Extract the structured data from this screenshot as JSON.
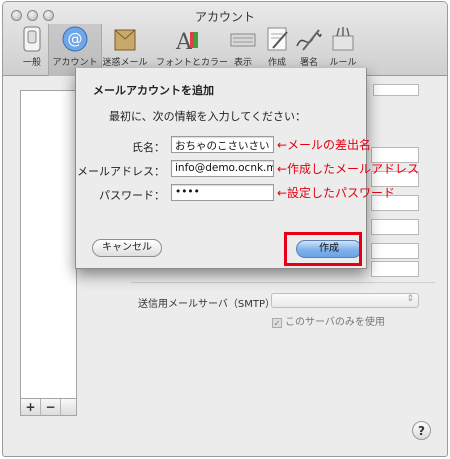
{
  "window": {
    "title": "アカウント"
  },
  "toolbar": {
    "items": [
      {
        "label": "一般",
        "icon": "switch-icon"
      },
      {
        "label": "アカウント",
        "icon": "at-sign-icon",
        "selected": true
      },
      {
        "label": "迷惑メール",
        "icon": "junk-mail-icon"
      },
      {
        "label": "フォントとカラー",
        "icon": "fonts-colors-icon"
      },
      {
        "label": "表示",
        "icon": "view-icon"
      },
      {
        "label": "作成",
        "icon": "compose-icon"
      },
      {
        "label": "署名",
        "icon": "signature-icon"
      },
      {
        "label": "ルール",
        "icon": "rules-icon"
      }
    ]
  },
  "sidebar": {
    "add_label": "+",
    "remove_label": "−"
  },
  "background": {
    "smtp_label": "送信用メールサーバ（SMTP）：",
    "smtp_checkbox_label": "このサーバのみを使用",
    "help_label": "?"
  },
  "sheet": {
    "title": "メールアカウントを追加",
    "subtitle": "最初に、次の情報を入力してください：",
    "fields": [
      {
        "label": "氏名：",
        "value": "おちゃのこさいさい"
      },
      {
        "label": "メールアドレス：",
        "value": "info@demo.ocnk.me"
      },
      {
        "label": "パスワード：",
        "value": "••••"
      }
    ],
    "cancel_label": "キャンセル",
    "create_label": "作成"
  },
  "annotations": {
    "note_name": "←メールの差出名",
    "note_email": "←作成したメールアドレス",
    "note_password": "←設定したパスワード",
    "color": "#e60012"
  }
}
